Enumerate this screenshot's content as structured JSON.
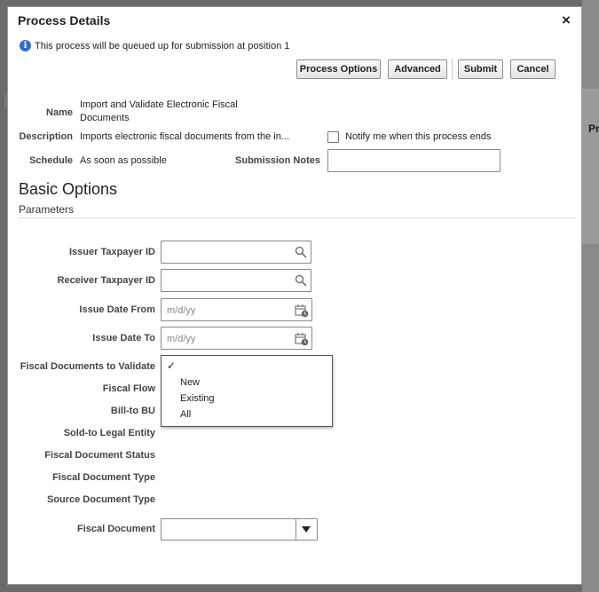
{
  "dialog": {
    "title": "Process Details",
    "close_glyph": "×",
    "info_message": "This process will be queued up for submission at position 1"
  },
  "toolbar": {
    "process_options": "Process Options",
    "advanced": "Advanced",
    "submit": "Submit",
    "cancel": "Cancel"
  },
  "details": {
    "name_label": "Name",
    "name_value_line1": "Import and Validate Electronic Fiscal",
    "name_value_line2": "Documents",
    "description_label": "Description",
    "description_value": "Imports electronic fiscal documents from the in...",
    "notify_label": "Notify me when this process ends",
    "notify_checked": false,
    "schedule_label": "Schedule",
    "schedule_value": "As soon as possible",
    "submission_notes_label": "Submission Notes",
    "submission_notes_value": ""
  },
  "basic_options": {
    "title": "Basic Options",
    "subtitle": "Parameters"
  },
  "parameters": {
    "issuer_taxpayer_id": {
      "label": "Issuer Taxpayer ID",
      "value": ""
    },
    "receiver_taxpayer_id": {
      "label": "Receiver Taxpayer ID",
      "value": ""
    },
    "issue_date_from": {
      "label": "Issue Date From",
      "placeholder": "m/d/yy"
    },
    "issue_date_to": {
      "label": "Issue Date To",
      "placeholder": "m/d/yy"
    },
    "fiscal_documents_to_validate": {
      "label": "Fiscal Documents to Validate",
      "selected_mark": "✓",
      "options": [
        "New",
        "Existing",
        "All"
      ]
    },
    "fiscal_flow": {
      "label": "Fiscal Flow"
    },
    "bill_to_bu": {
      "label": "Bill-to BU"
    },
    "sold_to_legal_entity": {
      "label": "Sold-to Legal Entity"
    },
    "fiscal_document_status": {
      "label": "Fiscal Document Status"
    },
    "fiscal_document_type": {
      "label": "Fiscal Document Type"
    },
    "source_document_type": {
      "label": "Source Document Type"
    },
    "fiscal_document": {
      "label": "Fiscal Document",
      "value": ""
    }
  },
  "background": {
    "column_header_fragment": "Pr"
  },
  "colors": {
    "info_icon": "#2f6fc9",
    "overlay": "#6b6b6b",
    "dialog_bg": "#ffffff"
  }
}
